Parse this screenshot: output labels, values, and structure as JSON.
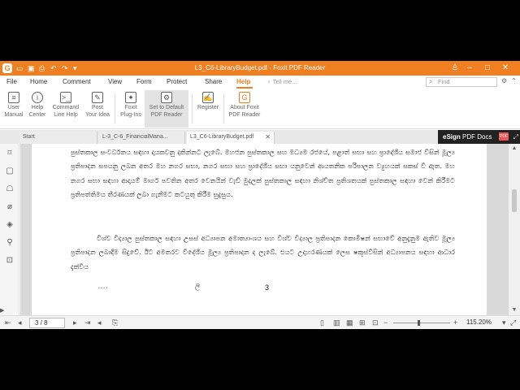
{
  "window": {
    "title": "L3_C6-LibraryBudget.pdf - Foxit PDF Reader",
    "logo_letter": "G"
  },
  "menu": {
    "items": [
      "File",
      "Home",
      "Comment",
      "View",
      "Form",
      "Protect",
      "Share",
      "Help"
    ],
    "active": "Help",
    "tell_me_placeholder": "Tell me...",
    "find_placeholder": "Find"
  },
  "ribbon": {
    "buttons": [
      {
        "line1": "User",
        "line2": "Manual",
        "icon": "book-icon"
      },
      {
        "line1": "Help",
        "line2": "Center",
        "icon": "help-icon"
      },
      {
        "line1": "Command",
        "line2": "Line Help",
        "icon": "command-line-icon"
      },
      {
        "line1": "Post",
        "line2": "Your Idea",
        "icon": "post-idea-icon"
      },
      {
        "line1": "Foxit",
        "line2": "Plug-Ins",
        "icon": "plugin-icon"
      },
      {
        "line1": "Set to Default",
        "line2": "PDF Reader",
        "icon": "default-reader-icon"
      },
      {
        "line1": "Register",
        "line2": "",
        "icon": "register-icon"
      },
      {
        "line1": "About Foxit",
        "line2": "PDF Reader",
        "icon": "about-icon"
      }
    ],
    "selected": "Set to Default"
  },
  "tabs": [
    {
      "label": "Start",
      "active": false
    },
    {
      "label": "L-3_C-6_FinancialMana...",
      "active": false
    },
    {
      "label": "L3_C6-LibraryBudget.pdf",
      "active": true
    }
  ],
  "esign": {
    "brand": "eSign",
    "label": "PDF Docs",
    "badge": "PDF"
  },
  "document": {
    "paragraph1": "පුස්තකාල සංවර්ධනය සඳහා දායකවනු දකින්නට ලැබේ. මහජන පුස්තකාල සහ මධ්‍යම රජයේ, පළාත් සභා සහ ප්‍රාදේශීය සමාජ විසින් මූල්‍ය ප්‍රතිපාදන සපයනු ලබන අතර මහ නගර සභා, නගර සභා සහ ප්‍රාදේශීය සභා යනුවෙන් ආයතනික පරිපාලන ව්‍යුහයක් සකස් වී ඇත. මහ නගර සභා සඳහා ආදායම් මාර්ග පවතින අතර වෙනයින් වැඩි මුදලක් පුස්තකාල සඳහා නිශ්චිත ප්‍රතිශතයක් පුස්තකාල සඳහා වෙන් කිරීමට ප්‍රතිපත්තිමය තීරණයක් ලබා ගැනීමට කටයුතු කිරීම සුදුසුය.",
    "paragraph2": "විශ්ව විද්‍යාල පුස්තකාල සඳහා උසස් අධ්‍යාපන අමාත්‍යාංශය සහ විශ්ව විද්‍යාල ප්‍රතිපාදන කොමිෂන් සභාවේ අනුදැනුම ඇතිව මූල්‍ය ප්‍රතිපාදන ලබාදීම සිදුවේ. ඊට අමතරව විදේශීය මූල්‍ය ප්‍රතිපාදන ද ලැබේ. එයට උදාහරණයක් ලෙස ෂකූස්විසින් අධ්‍යාපනය සඳහා ආධාර දැක්විය",
    "page_number": "3",
    "ink_mark1": "• •   • •",
    "ink_mark2": "ලී"
  },
  "status": {
    "page_display": "3 / 8",
    "zoom": "115.20%",
    "zoom_fraction": 0.45
  }
}
